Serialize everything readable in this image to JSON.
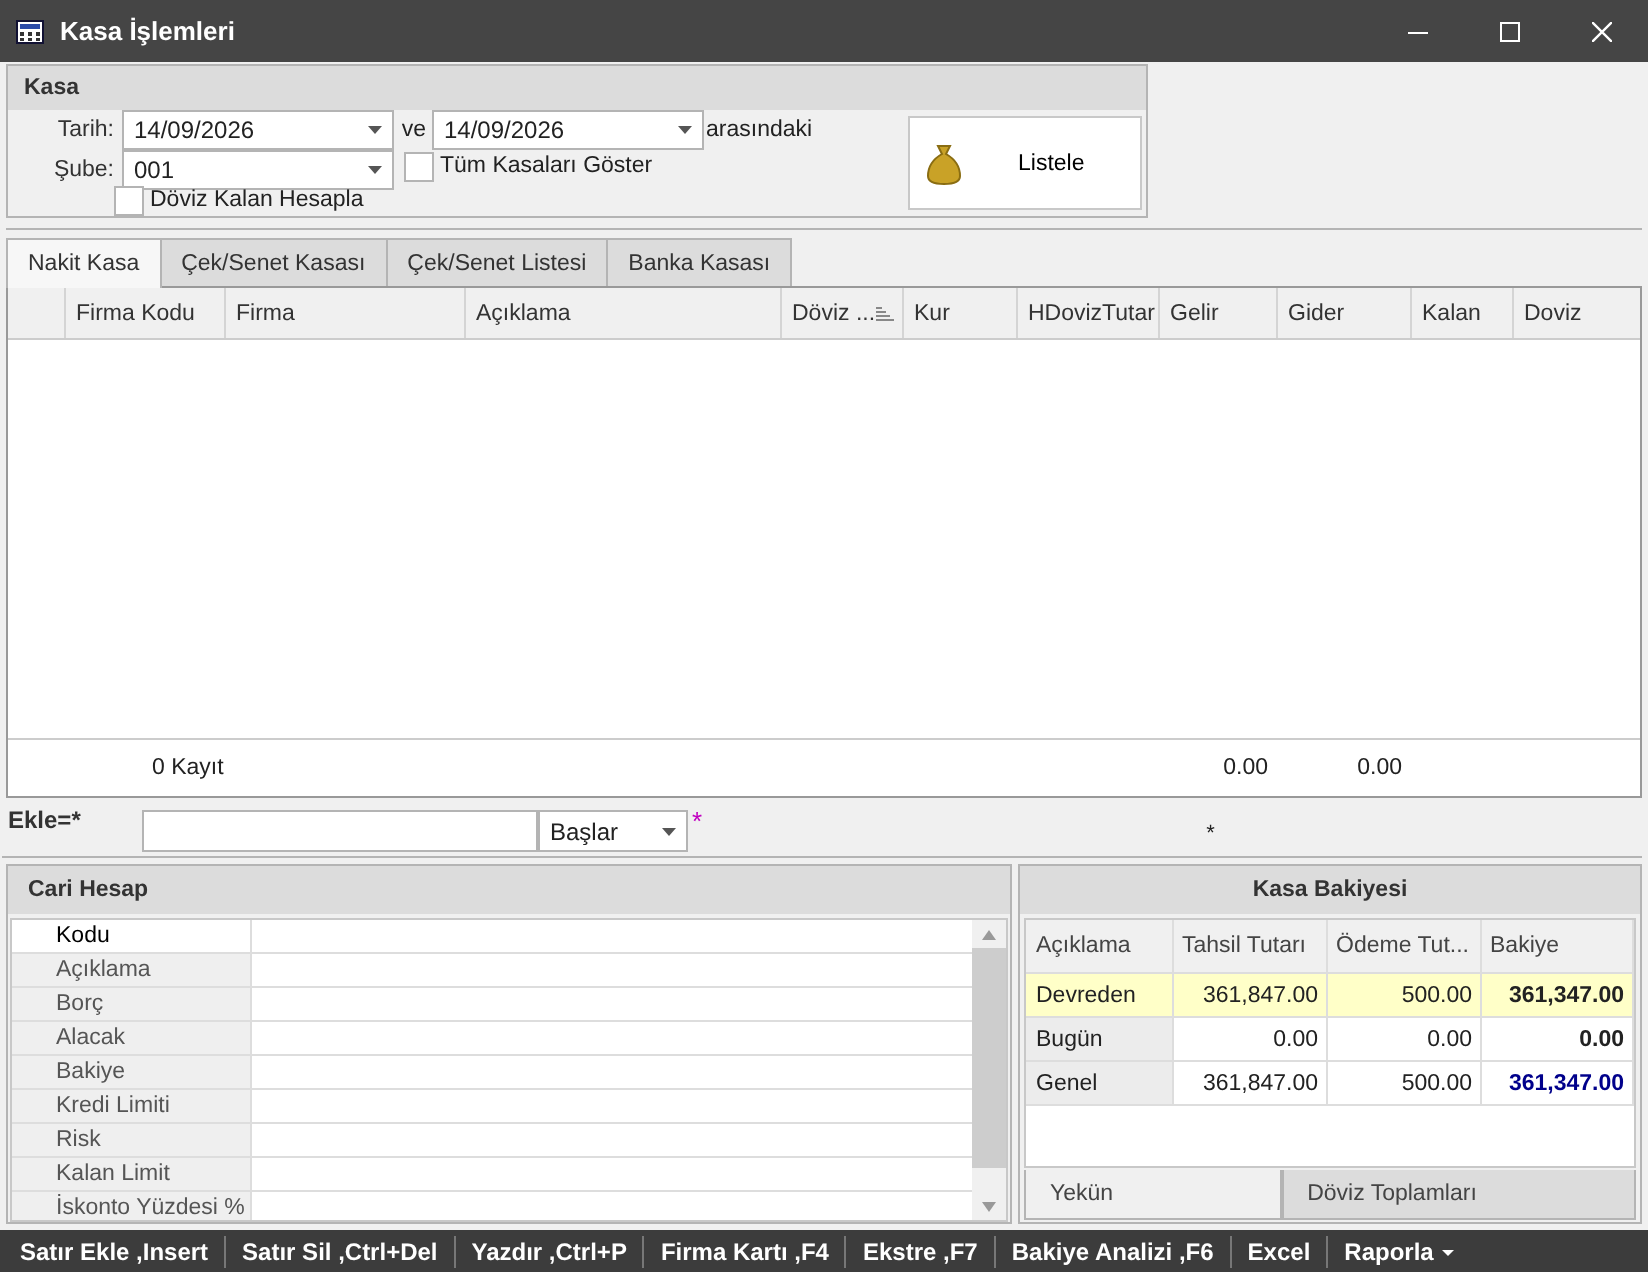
{
  "window": {
    "title": "Kasa İşlemleri"
  },
  "kasa": {
    "title": "Kasa",
    "tarih_label": "Tarih:",
    "date_from": "14/09/2026",
    "ve": "ve",
    "date_to": "14/09/2026",
    "range_suffix": "arasındaki",
    "sube_label": "Şube:",
    "sube": "001",
    "show_all": {
      "label": "Tüm Kasaları Göster",
      "checked": false
    },
    "doviz_kalan": {
      "label": "Döviz Kalan Hesapla",
      "checked": false
    },
    "listele": "Listele"
  },
  "tabs": [
    {
      "label": "Nakit Kasa",
      "selected": true
    },
    {
      "label": "Çek/Senet Kasası",
      "selected": false
    },
    {
      "label": "Çek/Senet Listesi",
      "selected": false
    },
    {
      "label": "Banka Kasası",
      "selected": false
    }
  ],
  "grid": {
    "columns": [
      {
        "label": "Firma Kodu",
        "sorted": false
      },
      {
        "label": "Firma",
        "sorted": false
      },
      {
        "label": "Açıklama",
        "sorted": false
      },
      {
        "label": "Döviz ...",
        "sorted": true
      },
      {
        "label": "Kur",
        "sorted": false
      },
      {
        "label": "HDovizTutar",
        "sorted": false
      },
      {
        "label": "Gelir",
        "sorted": false
      },
      {
        "label": "Gider",
        "sorted": false
      },
      {
        "label": "Kalan",
        "sorted": false
      },
      {
        "label": "Doviz",
        "sorted": false
      }
    ],
    "footer": {
      "count": "0 Kayıt",
      "gelir": "0.00",
      "gider": "0.00"
    }
  },
  "ekle": {
    "label": "Ekle=*",
    "mode": "Başlar",
    "marker": "*",
    "center_marker": "*"
  },
  "cari_hesap": {
    "title": "Cari Hesap",
    "fields": [
      {
        "label": "Kodu",
        "selected": true
      },
      {
        "label": "Açıklama",
        "selected": false
      },
      {
        "label": "Borç",
        "selected": false
      },
      {
        "label": "Alacak",
        "selected": false
      },
      {
        "label": "Bakiye",
        "selected": false
      },
      {
        "label": "Kredi Limiti",
        "selected": false
      },
      {
        "label": "Risk",
        "selected": false
      },
      {
        "label": "Kalan Limit",
        "selected": false
      },
      {
        "label": "İskonto Yüzdesi %",
        "selected": false
      }
    ]
  },
  "kasa_bakiyesi": {
    "title": "Kasa Bakiyesi",
    "columns": [
      "Açıklama",
      "Tahsil Tutarı",
      "Ödeme Tut...",
      "Bakiye"
    ],
    "rows": [
      {
        "cells": [
          "Devreden",
          "361,847.00",
          "500.00",
          "361,347.00"
        ],
        "highlighted": true,
        "total": false
      },
      {
        "cells": [
          "Bugün",
          "0.00",
          "0.00",
          "0.00"
        ],
        "highlighted": false,
        "total": false
      },
      {
        "cells": [
          "Genel",
          "361,847.00",
          "500.00",
          "361,347.00"
        ],
        "highlighted": false,
        "total": true
      }
    ],
    "tabs": [
      {
        "label": "Yekün",
        "selected": true
      },
      {
        "label": "Döviz Toplamları",
        "selected": false
      }
    ]
  },
  "toolbar": [
    {
      "label": "Satır Ekle ,Insert",
      "dropdown": false
    },
    {
      "label": "Satır Sil ,Ctrl+Del",
      "dropdown": false
    },
    {
      "label": "Yazdır ,Ctrl+P",
      "dropdown": false
    },
    {
      "label": "Firma Kartı ,F4",
      "dropdown": false
    },
    {
      "label": "Ekstre ,F7",
      "dropdown": false
    },
    {
      "label": "Bakiye Analizi ,F6",
      "dropdown": false
    },
    {
      "label": "Excel",
      "dropdown": false
    },
    {
      "label": "Raporla",
      "dropdown": true
    }
  ]
}
